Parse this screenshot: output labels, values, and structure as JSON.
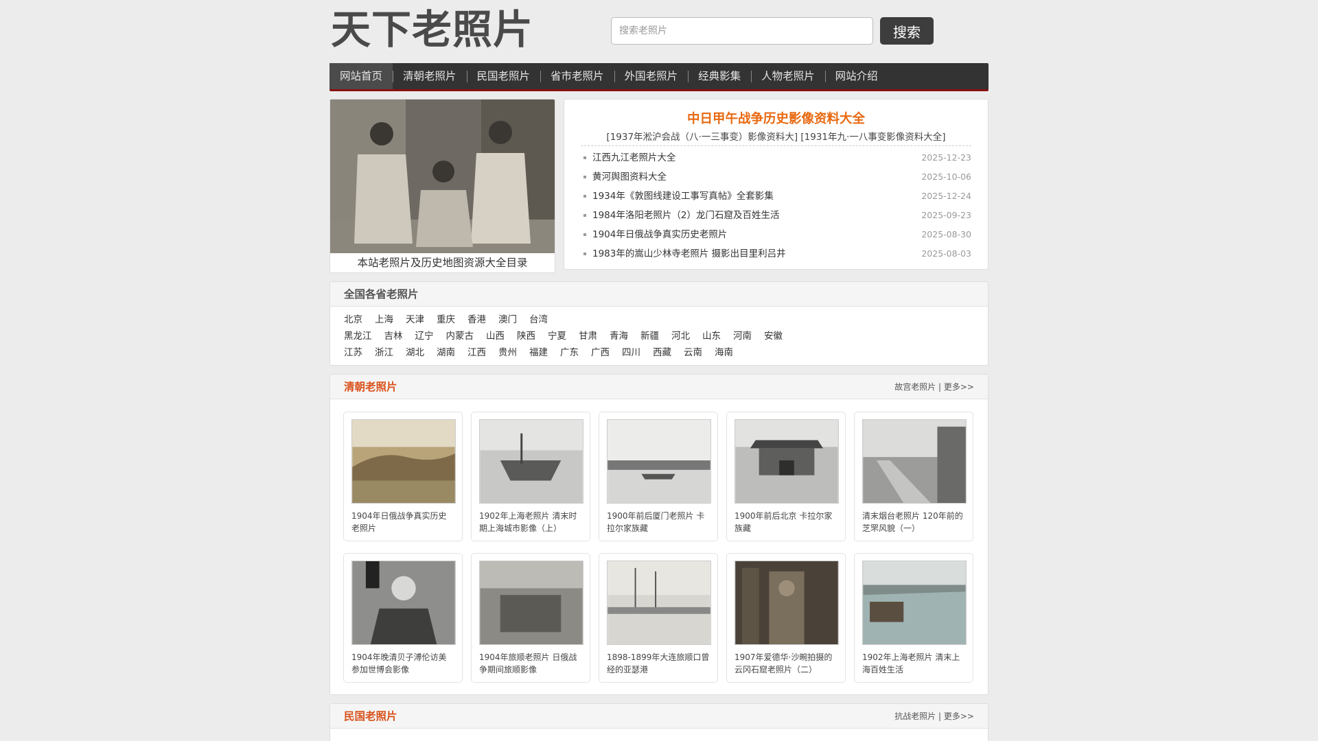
{
  "header": {
    "logo": "天下老照片",
    "search_placeholder": "搜索老照片",
    "search_button": "搜索"
  },
  "nav": {
    "items": [
      "网站首页",
      "清朝老照片",
      "民国老照片",
      "省市老照片",
      "外国老照片",
      "经典影集",
      "人物老照片",
      "网站介绍"
    ]
  },
  "feature": {
    "caption": "本站老照片及历史地图资源大全目录"
  },
  "news": {
    "title": "中日甲午战争历史影像资料大全",
    "links": "[1937年淞沪会战（八·一三事变）影像资料大] [1931年九·一八事变影像资料大全]",
    "items": [
      {
        "title": "江西九江老照片大全",
        "date": "2025-12-23"
      },
      {
        "title": "黄河舆图资料大全",
        "date": "2025-10-06"
      },
      {
        "title": "1934年《敦图线建设工事写真帖》全套影集",
        "date": "2025-12-24"
      },
      {
        "title": "1984年洛阳老照片（2）龙门石窟及百姓生活",
        "date": "2025-09-23"
      },
      {
        "title": "1904年日俄战争真实历史老照片",
        "date": "2025-08-30"
      },
      {
        "title": "1983年的嵩山少林寺老照片 摄影出目里利吕井",
        "date": "2025-08-03"
      }
    ]
  },
  "provinces": {
    "title": "全国各省老照片",
    "rows": [
      [
        "北京",
        "上海",
        "天津",
        "重庆",
        "香港",
        "澳门",
        "台湾"
      ],
      [
        "黑龙江",
        "吉林",
        "辽宁",
        "内蒙古",
        "山西",
        "陕西",
        "宁夏",
        "甘肃",
        "青海",
        "新疆",
        "河北",
        "山东",
        "河南",
        "安徽"
      ],
      [
        "江苏",
        "浙江",
        "湖北",
        "湖南",
        "江西",
        "贵州",
        "福建",
        "广东",
        "广西",
        "四川",
        "西藏",
        "云南",
        "海南"
      ]
    ]
  },
  "qing": {
    "title": "清朝老照片",
    "more_left": "故宫老照片",
    "more_right": "更多>>",
    "cards": [
      {
        "title": "1904年日俄战争真实历史老照片"
      },
      {
        "title": "1902年上海老照片 清末时期上海城市影像（上）"
      },
      {
        "title": "1900年前后厦门老照片 卡拉尔家族藏"
      },
      {
        "title": "1900年前后北京 卡拉尔家族藏"
      },
      {
        "title": "清末烟台老照片 120年前的芝罘风貌（一）"
      },
      {
        "title": "1904年晚清贝子溥伦访美参加世博会影像"
      },
      {
        "title": "1904年旅顺老照片 日俄战争期间旅顺影像"
      },
      {
        "title": "1898-1899年大连旅顺口曾经的亚瑟港"
      },
      {
        "title": "1907年爱德华·沙畹拍摄的云冈石窟老照片（二）"
      },
      {
        "title": "1902年上海老照片 清末上海百姓生活"
      }
    ]
  },
  "minguo": {
    "title": "民国老照片",
    "more_left": "抗战老照片",
    "more_right": "更多>>"
  }
}
